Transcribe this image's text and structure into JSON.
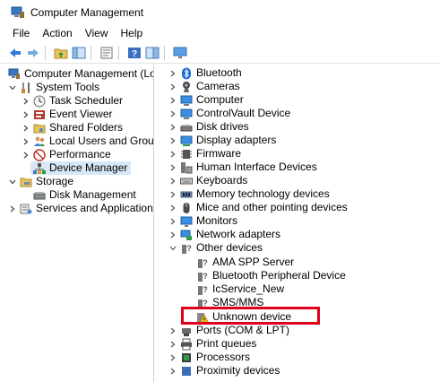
{
  "window": {
    "title": "Computer Management"
  },
  "menu": [
    "File",
    "Action",
    "View",
    "Help"
  ],
  "toolbar": {
    "icons": [
      "back-arrow-icon",
      "forward-arrow-icon",
      "up-folder-icon",
      "show-hide-tree-icon",
      "properties-icon",
      "help-icon",
      "console-icon",
      "monitor-icon"
    ]
  },
  "left_tree": [
    {
      "label": "Computer Management (Local",
      "icon": "computer-management-icon"
    },
    {
      "label": "System Tools",
      "icon": "system-tools-icon"
    },
    {
      "label": "Task Scheduler",
      "icon": "clock-icon"
    },
    {
      "label": "Event Viewer",
      "icon": "event-viewer-icon"
    },
    {
      "label": "Shared Folders",
      "icon": "shared-folder-icon"
    },
    {
      "label": "Local Users and Groups",
      "icon": "users-icon"
    },
    {
      "label": "Performance",
      "icon": "performance-icon"
    },
    {
      "label": "Device Manager",
      "icon": "device-manager-icon"
    },
    {
      "label": "Storage",
      "icon": "storage-icon"
    },
    {
      "label": "Disk Management",
      "icon": "disk-icon"
    },
    {
      "label": "Services and Applications",
      "icon": "services-icon"
    }
  ],
  "device_tree": [
    {
      "label": "Bluetooth",
      "icon": "bluetooth-icon"
    },
    {
      "label": "Cameras",
      "icon": "camera-icon"
    },
    {
      "label": "Computer",
      "icon": "computer-icon"
    },
    {
      "label": "ControlVault Device",
      "icon": "controlvault-icon"
    },
    {
      "label": "Disk drives",
      "icon": "disk-drive-icon"
    },
    {
      "label": "Display adapters",
      "icon": "display-adapter-icon"
    },
    {
      "label": "Firmware",
      "icon": "firmware-icon"
    },
    {
      "label": "Human Interface Devices",
      "icon": "hid-icon"
    },
    {
      "label": "Keyboards",
      "icon": "keyboard-icon"
    },
    {
      "label": "Memory technology devices",
      "icon": "memory-icon"
    },
    {
      "label": "Mice and other pointing devices",
      "icon": "mouse-icon"
    },
    {
      "label": "Monitors",
      "icon": "monitor-icon"
    },
    {
      "label": "Network adapters",
      "icon": "network-icon"
    },
    {
      "label": "Other devices",
      "icon": "other-devices-icon"
    },
    {
      "label": "AMA SPP Server",
      "icon": "unknown-device-icon"
    },
    {
      "label": "Bluetooth Peripheral Device",
      "icon": "unknown-device-icon"
    },
    {
      "label": "IcService_New",
      "icon": "unknown-device-icon"
    },
    {
      "label": "SMS/MMS",
      "icon": "unknown-device-icon"
    },
    {
      "label": "Unknown device",
      "icon": "warning-device-icon"
    },
    {
      "label": "Ports (COM & LPT)",
      "icon": "port-icon"
    },
    {
      "label": "Print queues",
      "icon": "printer-icon"
    },
    {
      "label": "Processors",
      "icon": "processor-icon"
    },
    {
      "label": "Proximity devices",
      "icon": "proximity-icon"
    }
  ],
  "colors": {
    "highlight_box": "#e0001b",
    "selection": "#d8e7f6"
  }
}
